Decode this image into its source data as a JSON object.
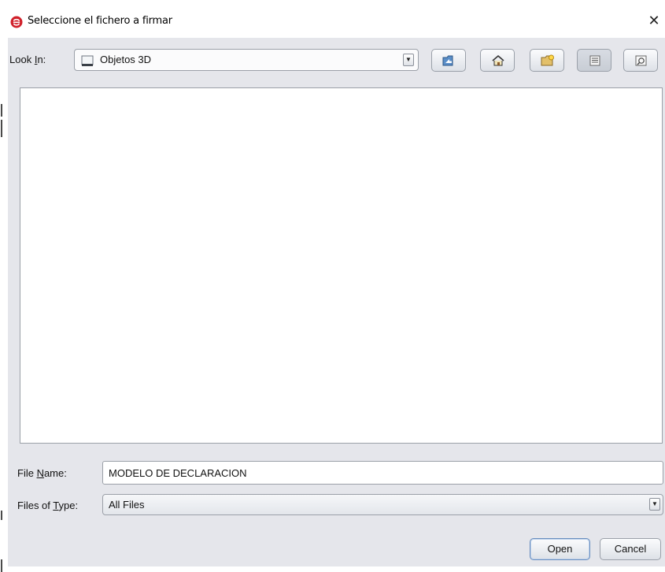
{
  "window": {
    "title": "Seleccione el fichero a firmar",
    "close_symbol": "✕"
  },
  "look_in": {
    "label_prefix": "Look ",
    "label_mnemonic": "I",
    "label_suffix": "n:",
    "value": "Objetos 3D",
    "arrow": "▼"
  },
  "toolbar": {
    "buttons": [
      {
        "name": "up-one-level",
        "icon": "folder-up-icon"
      },
      {
        "name": "home",
        "icon": "home-icon"
      },
      {
        "name": "create-new-folder",
        "icon": "new-folder-icon"
      },
      {
        "name": "list-view",
        "icon": "list-view-icon",
        "pressed": true
      },
      {
        "name": "details-view",
        "icon": "details-view-icon"
      }
    ]
  },
  "file_name": {
    "label_prefix": "File ",
    "label_mnemonic": "N",
    "label_suffix": "ame:",
    "value": "MODELO DE DECLARACION"
  },
  "files_of_type": {
    "label_prefix": "Files of ",
    "label_mnemonic": "T",
    "label_suffix": "ype:",
    "value": "All Files",
    "arrow": "▼"
  },
  "actions": {
    "open_label": "Open",
    "cancel_label": "Cancel"
  },
  "colors": {
    "dialog_bg": "#e5e6eb",
    "app_icon_red": "#d0202a",
    "default_button_border": "#6a8fbf"
  }
}
